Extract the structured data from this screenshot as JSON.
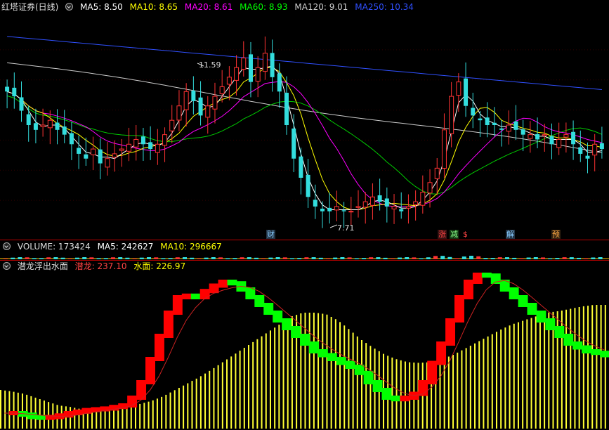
{
  "header": {
    "title": "红塔证券(日线)",
    "ma": [
      {
        "label": "MA5: 8.50",
        "color": "#ffffff"
      },
      {
        "label": "MA10: 8.65",
        "color": "#ffff00"
      },
      {
        "label": "MA20: 8.61",
        "color": "#ff00ff"
      },
      {
        "label": "MA60: 8.93",
        "color": "#00ff00"
      },
      {
        "label": "MA120: 9.01",
        "color": "#cccccc"
      },
      {
        "label": "MA250: 10.34",
        "color": "#3050ff"
      }
    ]
  },
  "volume_header": {
    "label": "VOLUME: 173424",
    "ma5": "MA5: 242627",
    "ma10": "MA10: 296667"
  },
  "indicator_header": {
    "name": "潜龙浮出水面",
    "qianlong": "潜龙: 237.10",
    "shuimian": "水面: 226.97"
  },
  "annotations": {
    "high": "11.59",
    "low": "7.71",
    "events": [
      {
        "text": "财",
        "color": "#88ccff",
        "bg": "#223344"
      },
      {
        "text": "涨",
        "color": "#ff4444",
        "bg": "#331111"
      },
      {
        "text": "减",
        "color": "#88ff88",
        "bg": "#113311"
      },
      {
        "text": "$",
        "color": "#ff4444",
        "bg": "#000000"
      },
      {
        "text": "解",
        "color": "#88ccff",
        "bg": "#223344"
      },
      {
        "text": "预",
        "color": "#ffaa44",
        "bg": "#332211"
      }
    ]
  },
  "chart_data": [
    {
      "type": "candlestick",
      "title": "红塔证券(日线)",
      "y_high": 11.59,
      "y_low": 7.71,
      "closes": [
        10.3,
        10.2,
        9.9,
        9.6,
        9.5,
        9.6,
        9.7,
        9.5,
        9.4,
        9.2,
        9.0,
        8.9,
        9.1,
        8.8,
        8.9,
        9.0,
        9.1,
        9.2,
        9.3,
        9.2,
        9.1,
        9.2,
        9.4,
        9.7,
        10.0,
        10.3,
        10.1,
        9.8,
        10.0,
        10.2,
        10.4,
        10.6,
        10.8,
        11.0,
        10.5,
        10.8,
        11.1,
        10.6,
        10.3,
        9.6,
        8.9,
        8.5,
        8.1,
        7.9,
        7.8,
        7.8,
        7.9,
        7.8,
        7.8,
        7.9,
        8.0,
        8.1,
        8.0,
        7.9,
        7.9,
        7.8,
        7.9,
        8.0,
        8.2,
        8.4,
        8.7,
        9.5,
        10.2,
        10.5,
        10.0,
        9.8,
        9.7,
        9.6,
        9.6,
        9.5,
        9.6,
        9.5,
        9.4,
        9.4,
        9.3,
        9.4,
        9.2,
        9.3,
        9.4,
        9.2,
        9.0,
        8.9,
        9.2,
        9.1
      ]
    },
    {
      "type": "bar",
      "title": "VOLUME",
      "values": [
        173424
      ],
      "ma5": 242627,
      "ma10": 296667
    },
    {
      "type": "line",
      "title": "潜龙浮出水面",
      "series": [
        {
          "name": "潜龙",
          "last": 237.1,
          "values": [
            20,
            20,
            18,
            15,
            14,
            15,
            17,
            20,
            22,
            24,
            25,
            26,
            28,
            30,
            40,
            60,
            90,
            120,
            150,
            170,
            172,
            170,
            178,
            185,
            190,
            188,
            180,
            170,
            160,
            150,
            140,
            130,
            120,
            110,
            100,
            95,
            90,
            85,
            80,
            72,
            60,
            50,
            40,
            38,
            40,
            45,
            60,
            85,
            110,
            140,
            170,
            190,
            200,
            198,
            190,
            180,
            170,
            160,
            150,
            140,
            130,
            120,
            110,
            105,
            100,
            98,
            95
          ]
        },
        {
          "name": "水面",
          "last": 226.97,
          "values": [
            50,
            48,
            45,
            40,
            35,
            30,
            28,
            25,
            24,
            24,
            25,
            28,
            32,
            36,
            42,
            50,
            58,
            66,
            75,
            85,
            95,
            105,
            115,
            125,
            135,
            145,
            150,
            150,
            148,
            140,
            128,
            115,
            105,
            96,
            90,
            86,
            85,
            86,
            90,
            96,
            104,
            112,
            120,
            128,
            135,
            140,
            145,
            150,
            152,
            155,
            158,
            160,
            160
          ]
        }
      ]
    }
  ]
}
